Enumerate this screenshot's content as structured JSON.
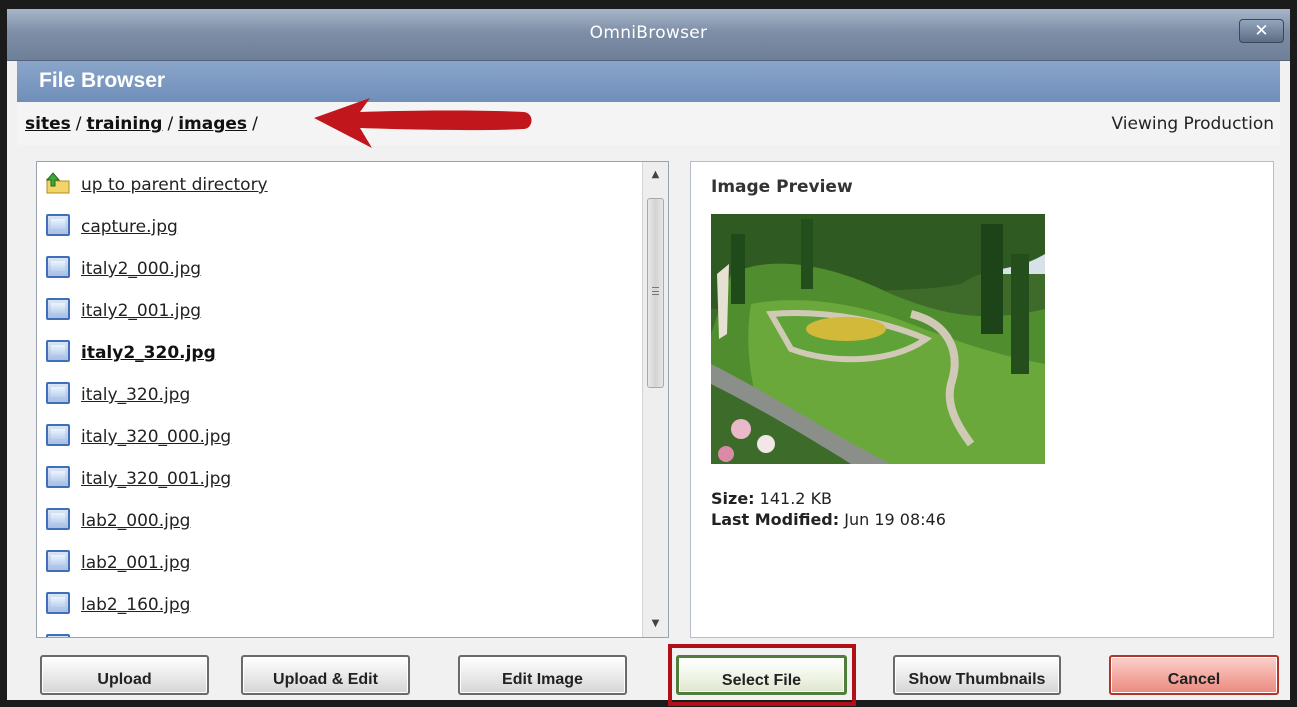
{
  "window": {
    "title": "OmniBrowser",
    "close_label": "✕"
  },
  "header": {
    "title": "File Browser"
  },
  "breadcrumb": {
    "items": [
      "sites",
      "training",
      "images"
    ],
    "separator": "/",
    "status": "Viewing Production"
  },
  "files": {
    "parent_label": "up to parent directory",
    "items": [
      {
        "name": "capture.jpg"
      },
      {
        "name": "italy2_000.jpg"
      },
      {
        "name": "italy2_001.jpg"
      },
      {
        "name": "italy2_320.jpg",
        "selected": true
      },
      {
        "name": "italy_320.jpg"
      },
      {
        "name": "italy_320_000.jpg"
      },
      {
        "name": "italy_320_001.jpg"
      },
      {
        "name": "lab2_000.jpg"
      },
      {
        "name": "lab2_001.jpg"
      },
      {
        "name": "lab2_160.jpg"
      }
    ]
  },
  "preview": {
    "title": "Image Preview",
    "size_label": "Size:",
    "size_value": "141.2 KB",
    "modified_label": "Last Modified:",
    "modified_value": "Jun 19 08:46"
  },
  "buttons": {
    "upload": "Upload",
    "upload_edit": "Upload & Edit",
    "edit_image": "Edit Image",
    "select_file": "Select File",
    "show_thumbnails": "Show Thumbnails",
    "cancel": "Cancel"
  },
  "colors": {
    "titlebar": "#7e8ea6",
    "header": "#7b98c0",
    "highlight_frame": "#b21019",
    "annotation_arrow": "#c0161c",
    "cancel_button": "#f2a59c"
  }
}
